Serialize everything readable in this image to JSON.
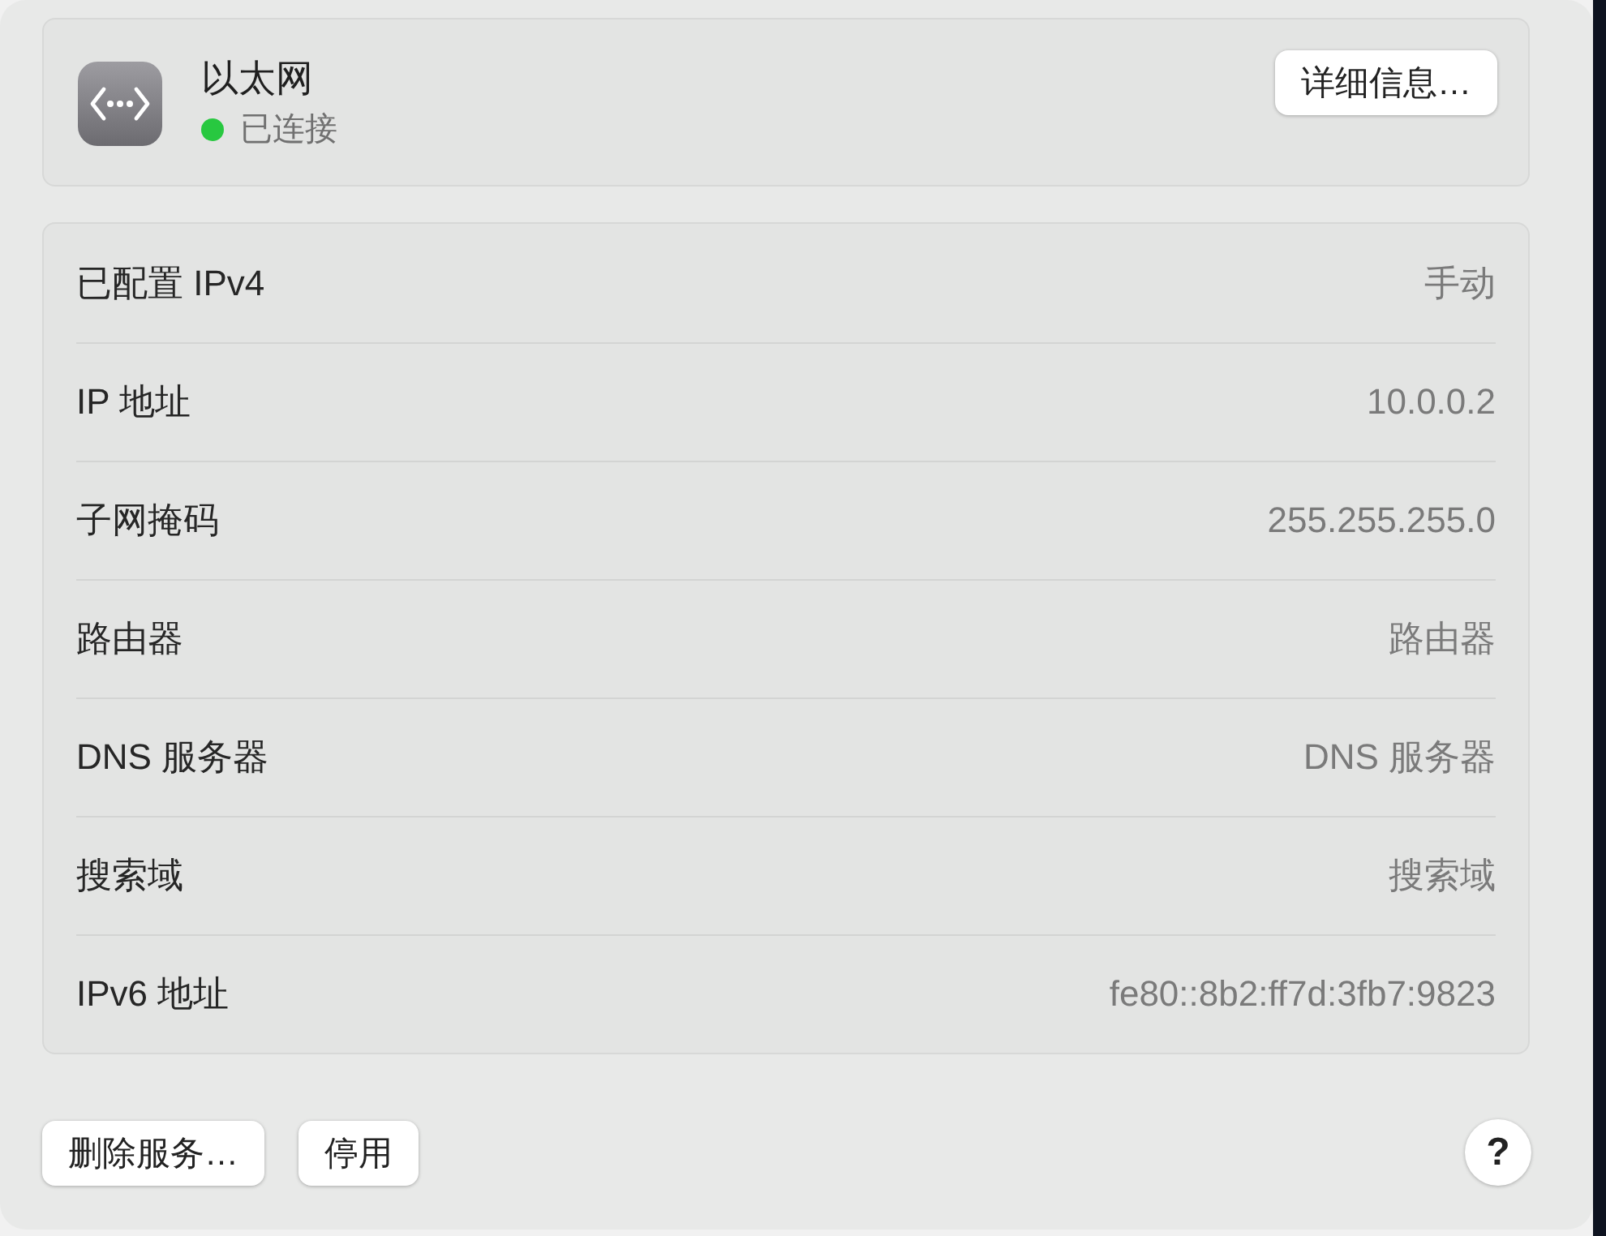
{
  "service": {
    "name": "以太网",
    "status": {
      "label": "已连接",
      "connected": true
    },
    "details_button": "详细信息…"
  },
  "settings": [
    {
      "label": "已配置 IPv4",
      "value": "手动"
    },
    {
      "label": "IP 地址",
      "value": "10.0.0.2"
    },
    {
      "label": "子网掩码",
      "value": "255.255.255.0"
    },
    {
      "label": "路由器",
      "value": "路由器"
    },
    {
      "label": "DNS 服务器",
      "value": "DNS 服务器"
    },
    {
      "label": "搜索域",
      "value": "搜索域"
    },
    {
      "label": "IPv6 地址",
      "value": "fe80::8b2:ff7d:3fb7:9823"
    }
  ],
  "buttons": [
    {
      "label": "删除服务…"
    },
    {
      "label": "停用"
    }
  ],
  "help_button": "?"
}
